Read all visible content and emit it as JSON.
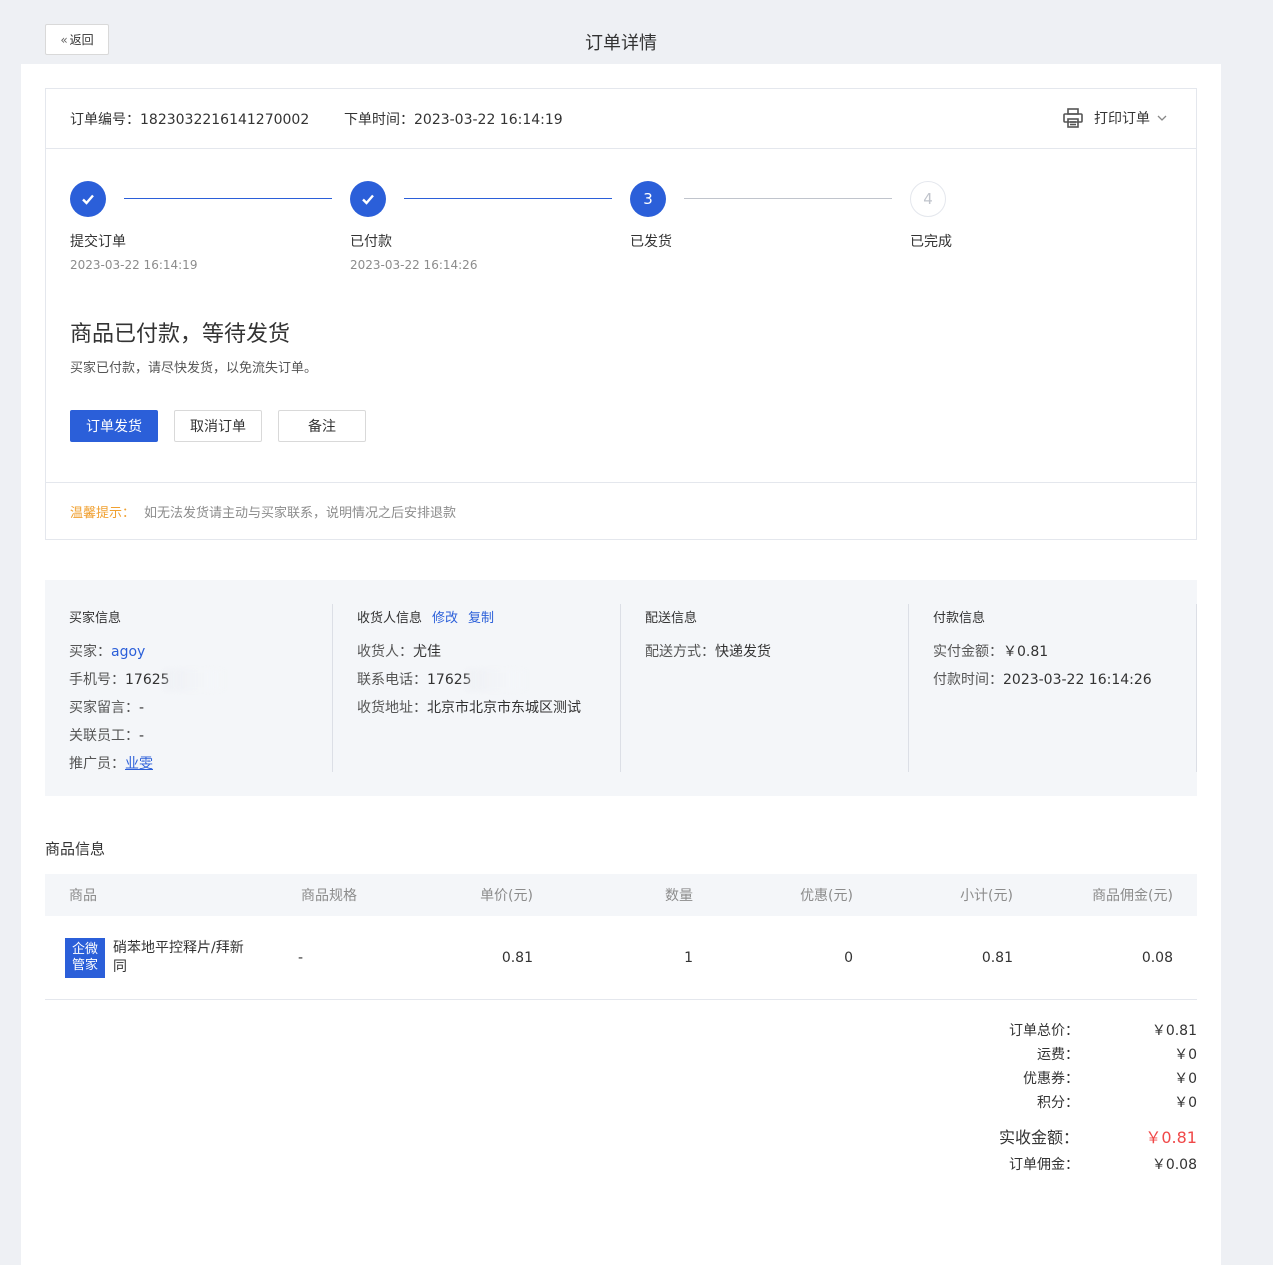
{
  "header": {
    "back_label": "返回",
    "title": "订单详情"
  },
  "order": {
    "no_label": "订单编号：",
    "no_value": "1823032216141270002",
    "time_label": "下单时间：",
    "time_value": "2023-03-22 16:14:19",
    "print_label": "打印订单"
  },
  "steps": [
    {
      "label": "提交订单",
      "time": "2023-03-22 16:14:19",
      "state": "done",
      "num": "1"
    },
    {
      "label": "已付款",
      "time": "2023-03-22 16:14:26",
      "state": "done",
      "num": "2"
    },
    {
      "label": "已发货",
      "time": "",
      "state": "active",
      "num": "3"
    },
    {
      "label": "已完成",
      "time": "",
      "state": "todo",
      "num": "4"
    }
  ],
  "status": {
    "title": "商品已付款，等待发货",
    "desc": "买家已付款，请尽快发货，以免流失订单。"
  },
  "actions": {
    "ship": "订单发货",
    "cancel": "取消订单",
    "remark": "备注"
  },
  "tip": {
    "label": "温馨提示：",
    "text": "如无法发货请主动与买家联系，说明情况之后安排退款"
  },
  "buyer": {
    "title": "买家信息",
    "buyer_label": "买家：",
    "buyer_value": "agoy",
    "phone_label": "手机号：",
    "phone_value": "17625",
    "message_label": "买家留言：",
    "message_value": "-",
    "staff_label": "关联员工：",
    "staff_value": "-",
    "promoter_label": "推广员：",
    "promoter_value": "业雯"
  },
  "receiver": {
    "title": "收货人信息",
    "edit": "修改",
    "copy": "复制",
    "name_label": "收货人：",
    "name_value": "尤佳",
    "phone_label": "联系电话：",
    "phone_value": "17625",
    "address_label": "收货地址：",
    "address_value": "北京市北京市东城区测试"
  },
  "delivery": {
    "title": "配送信息",
    "method_label": "配送方式：",
    "method_value": "快递发货"
  },
  "payment": {
    "title": "付款信息",
    "amount_label": "实付金额：",
    "amount_value": "￥0.81",
    "time_label": "付款时间：",
    "time_value": "2023-03-22 16:14:26"
  },
  "goods": {
    "title": "商品信息",
    "columns": [
      "商品",
      "商品规格",
      "单价(元)",
      "数量",
      "优惠(元)",
      "小计(元)",
      "商品佣金(元)"
    ],
    "rows": [
      {
        "logo_text": "企微管家",
        "name": "硝苯地平控释片/拜新同",
        "spec": "-",
        "price": "0.81",
        "qty": "1",
        "discount": "0",
        "subtotal": "0.81",
        "commission": "0.08"
      }
    ]
  },
  "summary": {
    "total_label": "订单总价：",
    "total_value": "￥0.81",
    "freight_label": "运费：",
    "freight_value": "￥0",
    "coupon_label": "优惠券：",
    "coupon_value": "￥0",
    "points_label": "积分：",
    "points_value": "￥0",
    "received_label": "实收金额：",
    "received_value": "￥0.81",
    "commission_label": "订单佣金：",
    "commission_value": "￥0.08"
  },
  "colors": {
    "primary": "#2b5fd9",
    "tip": "#f0a030",
    "amount_red": "#f04848"
  }
}
